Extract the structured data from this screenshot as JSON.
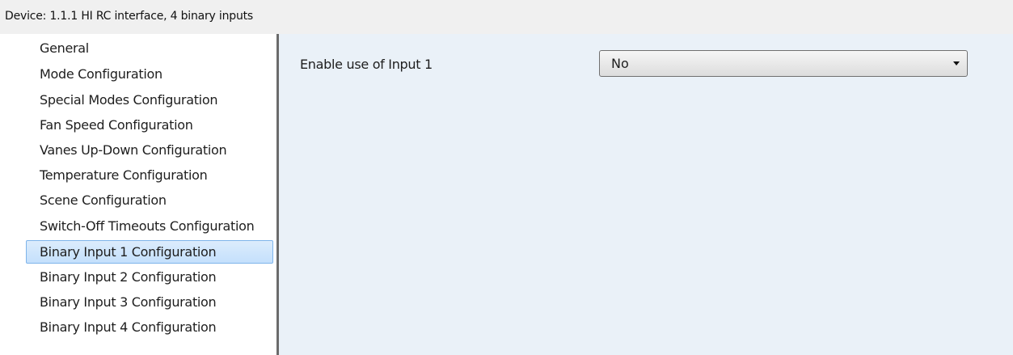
{
  "window": {
    "title": "Device: 1.1.1  HI RC interface, 4 binary inputs"
  },
  "sidebar": {
    "items": [
      {
        "label": "General"
      },
      {
        "label": "Mode Configuration"
      },
      {
        "label": "Special Modes Configuration"
      },
      {
        "label": "Fan Speed Configuration"
      },
      {
        "label": "Vanes Up-Down Configuration"
      },
      {
        "label": "Temperature Configuration"
      },
      {
        "label": "Scene Configuration"
      },
      {
        "label": "Switch-Off Timeouts Configuration"
      },
      {
        "label": "Binary Input 1 Configuration",
        "selected": true
      },
      {
        "label": "Binary Input 2 Configuration"
      },
      {
        "label": "Binary Input 3 Configuration"
      },
      {
        "label": "Binary Input 4 Configuration"
      }
    ]
  },
  "main": {
    "param": {
      "label": "Enable use of Input 1",
      "value": "No"
    }
  },
  "colors": {
    "selection_bg": "#c4e0fc",
    "selection_border": "#7eb4ea",
    "content_bg": "#eaf1f8",
    "title_bar_bg": "#f0f0f0"
  },
  "icons": {
    "dropdown": "chevron-down-icon"
  }
}
